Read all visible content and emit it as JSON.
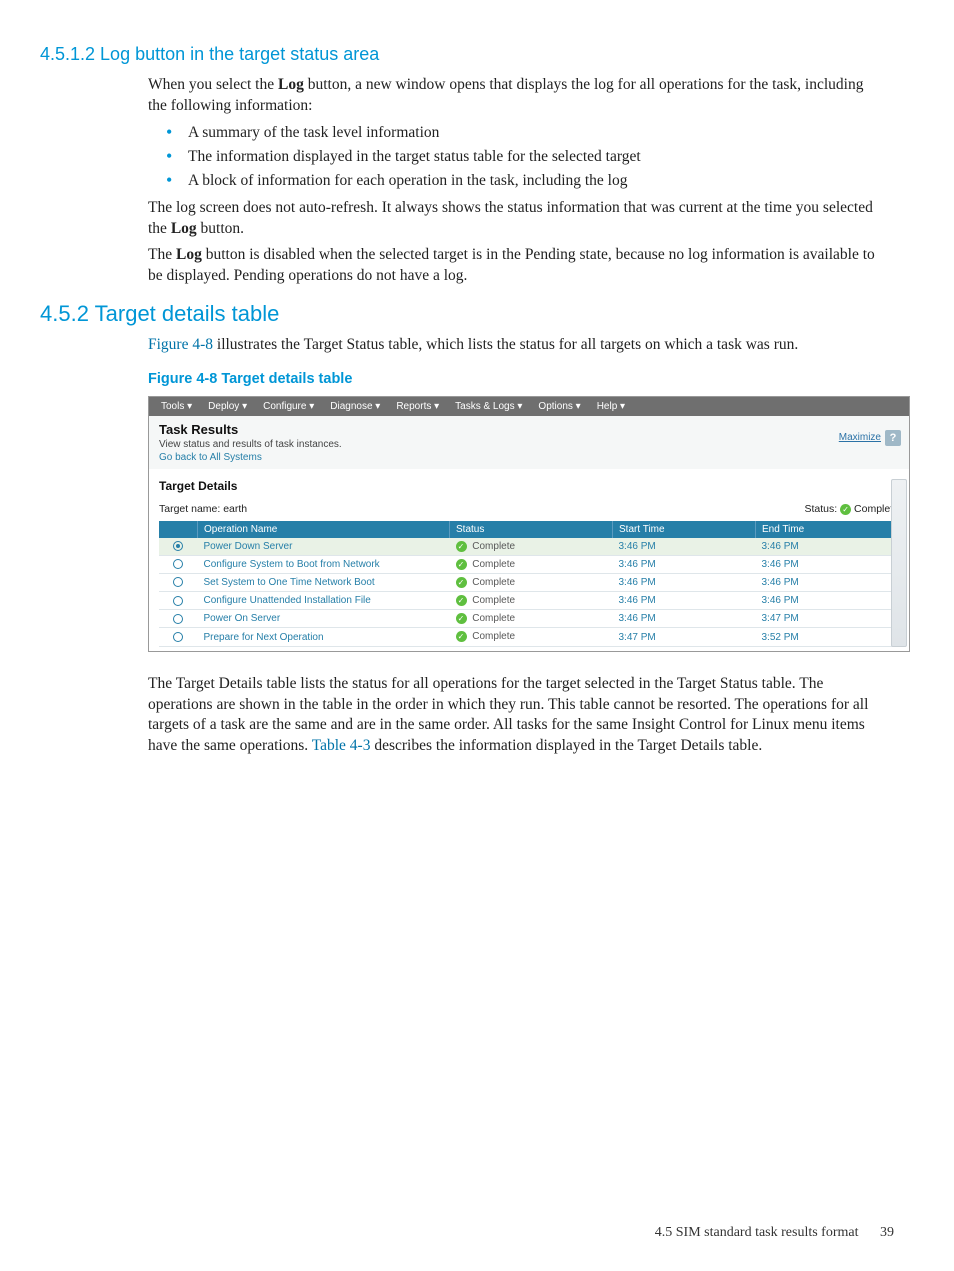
{
  "section_4512": {
    "heading": "4.5.1.2 Log button in the target status area",
    "p1_a": "When you select the ",
    "p1_b": " button, a new window opens that displays the log for all operations for the task, including the following information:",
    "bullets": [
      "A summary of the task level information",
      "The information displayed in the target status table for the selected target",
      "A block of information for each operation in the task, including the log"
    ],
    "p2_a": "The log screen does not auto-refresh. It always shows the status information that was current at the time you selected the ",
    "p2_b": " button.",
    "p3_a": "The ",
    "p3_b": " button is disabled when the selected target is in the Pending state, because no log information is available to be displayed. Pending operations do not have a log.",
    "log_label": "Log"
  },
  "section_452": {
    "heading": "4.5.2 Target details table",
    "p1_link": "Figure 4-8",
    "p1_rest": " illustrates the Target Status table, which lists the status for all targets on which a task was run.",
    "fig_caption": "Figure 4-8 Target details table",
    "after_p_a": "The Target Details table lists the status for all operations for the target selected in the Target Status table. The operations are shown in the table in the order in which they run. This table cannot be resorted. The operations for all targets of a task are the same and are in the same order. All tasks for the same Insight Control for Linux menu items have the same operations. ",
    "after_link": "Table 4-3",
    "after_p_b": " describes the information displayed in the Target Details table."
  },
  "screenshot": {
    "menu": [
      "Tools ▾",
      "Deploy ▾",
      "Configure ▾",
      "Diagnose ▾",
      "Reports ▾",
      "Tasks & Logs ▾",
      "Options ▾",
      "Help ▾"
    ],
    "header": {
      "title": "Task Results",
      "subtitle": "View status and results of task instances.",
      "goback": "Go back to All Systems",
      "maximize": "Maximize",
      "help": "?"
    },
    "panel": {
      "title": "Target Details",
      "tname_label": "Target name: ",
      "tname_value": "earth",
      "status_label": "Status: ",
      "status_value": "Complete"
    },
    "columns": [
      "",
      "Operation Name",
      "Status",
      "Start Time",
      "End Time"
    ],
    "rows": [
      {
        "sel": true,
        "op": "Power Down Server",
        "status": "Complete",
        "start": "3:46 PM",
        "end": "3:46 PM",
        "hl": true
      },
      {
        "sel": false,
        "op": "Configure System to Boot from Network",
        "status": "Complete",
        "start": "3:46 PM",
        "end": "3:46 PM"
      },
      {
        "sel": false,
        "op": "Set System to One Time Network Boot",
        "status": "Complete",
        "start": "3:46 PM",
        "end": "3:46 PM"
      },
      {
        "sel": false,
        "op": "Configure Unattended Installation File",
        "status": "Complete",
        "start": "3:46 PM",
        "end": "3:46 PM"
      },
      {
        "sel": false,
        "op": "Power On Server",
        "status": "Complete",
        "start": "3:46 PM",
        "end": "3:47 PM"
      },
      {
        "sel": false,
        "op": "Prepare for Next Operation",
        "status": "Complete",
        "start": "3:47 PM",
        "end": "3:52 PM"
      }
    ]
  },
  "footer": {
    "text": "4.5 SIM standard task results format",
    "page": "39"
  }
}
